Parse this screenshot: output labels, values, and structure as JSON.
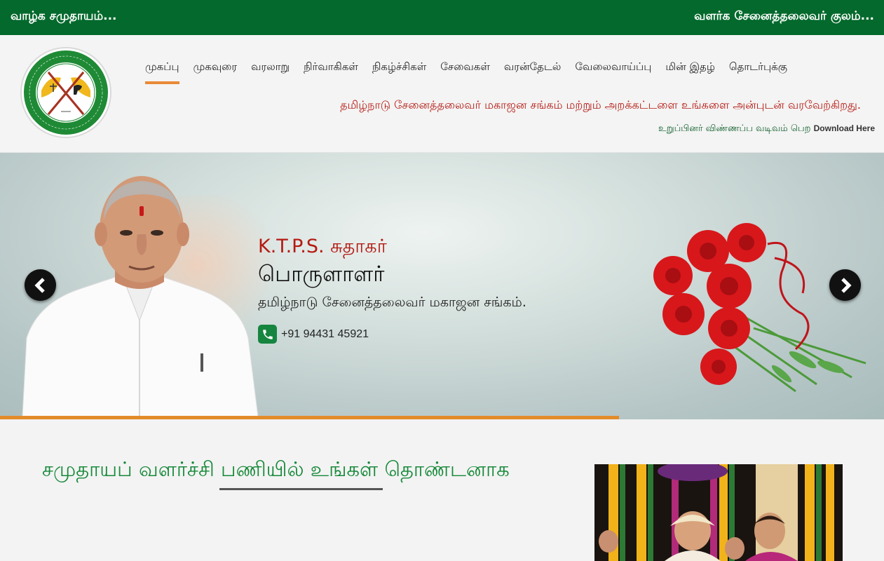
{
  "topbar": {
    "left_text": "வாழ்க சமுதாயம்...",
    "right_text": "வளர்க சேனைத்தலைவர் குலம்..."
  },
  "header": {
    "logo_name": "association-seal-logo",
    "nav": [
      {
        "label": "முகப்பு",
        "active": true
      },
      {
        "label": "முகவுரை",
        "active": false
      },
      {
        "label": "வரலாறு",
        "active": false
      },
      {
        "label": "நிர்வாகிகள்",
        "active": false
      },
      {
        "label": "நிகழ்ச்சிகள்",
        "active": false
      },
      {
        "label": "சேவைகள்",
        "active": false
      },
      {
        "label": "வரன்தேடல்",
        "active": false
      },
      {
        "label": "வேலைவாய்ப்பு",
        "active": false
      },
      {
        "label": "மின் இதழ்",
        "active": false
      },
      {
        "label": "தொடர்புக்கு",
        "active": false
      }
    ],
    "welcome": "தமிழ்நாடு சேனைத்தலைவர் மகாஜன சங்கம் மற்றும் அறக்கட்டளை உங்களை அன்புடன் வரவேற்கிறது.",
    "download_prefix": "உறுப்பினர் விண்ணப்ப வடிவம் பெற",
    "download_link": "Download Here"
  },
  "hero": {
    "name": "K.T.P.S. சுதாகர்",
    "role": "பொருளாளர்",
    "organization": "தமிழ்நாடு சேனைத்தலைவர் மகாஜன சங்கம்.",
    "phone": "+91 94431 45921",
    "slide_progress_percent": 70
  },
  "colors": {
    "topbar_green": "#03692c",
    "accent_orange": "#e98a36",
    "welcome_red": "#b41a12",
    "title_green": "#17893a"
  },
  "section": {
    "title": "சமுதாயப் வளர்ச்சி பணியில் உங்கள் தொண்டனாக"
  }
}
